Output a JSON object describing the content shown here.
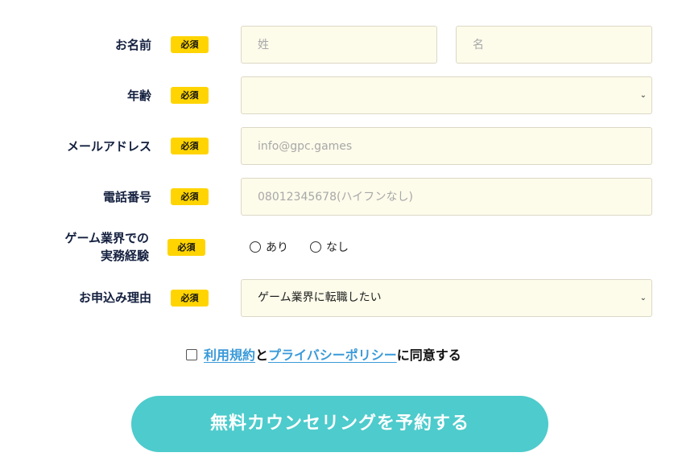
{
  "form": {
    "name": {
      "label": "お名前",
      "badge": "必須",
      "last_placeholder": "姓",
      "first_placeholder": "名"
    },
    "age": {
      "label": "年齢",
      "badge": "必須",
      "selected": ""
    },
    "email": {
      "label": "メールアドレス",
      "badge": "必須",
      "placeholder": "info@gpc.games"
    },
    "phone": {
      "label": "電話番号",
      "badge": "必須",
      "placeholder": "08012345678(ハイフンなし)"
    },
    "experience": {
      "label_line1": "ゲーム業界での",
      "label_line2": "実務経験",
      "badge": "必須",
      "options": [
        "あり",
        "なし"
      ]
    },
    "reason": {
      "label": "お申込み理由",
      "badge": "必須",
      "selected": "ゲーム業界に転職したい"
    }
  },
  "agreement": {
    "terms_link": "利用規約",
    "and_text": "と",
    "privacy_link": "プライバシーポリシー",
    "suffix": "に同意する"
  },
  "submit": {
    "label": "無料カウンセリングを予約する"
  },
  "colors": {
    "badge": "#ffd400",
    "field_bg": "#fdfbea",
    "link": "#3a9ad9",
    "button": "#4ecbcc"
  }
}
